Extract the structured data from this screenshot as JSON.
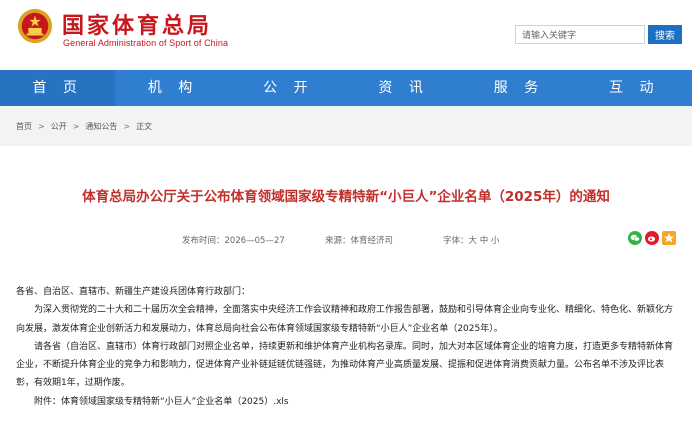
{
  "header": {
    "title_cn": "国家体育总局",
    "title_en": "General Administration of Sport of China",
    "emblem_icon": "national-emblem-icon",
    "search_placeholder": "请输入关键字",
    "search_button": "搜索"
  },
  "colors": {
    "brand_red": "#c8161d",
    "nav_blue": "#2f7ed0",
    "title_red": "#c22f2b",
    "search_blue": "#1c6fc3"
  },
  "nav": {
    "items": [
      "首 页",
      "机 构",
      "公 开",
      "资 讯",
      "服 务",
      "互 动"
    ]
  },
  "breadcrumb": {
    "items": [
      "首页",
      "公开",
      "通知公告",
      "正文"
    ],
    "separator": ">"
  },
  "article": {
    "title": "体育总局办公厅关于公布体育领域国家级专精特新“小巨人”企业名单（2025年）的通知",
    "date": "发布时间：2026—05—27",
    "source": "来源：体育经济司",
    "font_size": "字体：大 中 小",
    "share_icons": [
      "wechat-icon",
      "weibo-icon",
      "favorite-icon"
    ],
    "paragraphs": [
      "各省、自治区、直辖市、新疆生产建设兵团体育行政部门：",
      "为深入贯彻党的二十大和二十届历次全会精神，全面落实中央经济工作会议精神和政府工作报告部署，鼓励和引导体育企业向专业化、精细化、特色化、新颖化方向发展，激发体育企业创新活力和发展动力，体育总局向社会公布体育领域国家级专精特新“小巨人”企业名单（2025年）。",
      "请各省（自治区、直辖市）体育行政部门对照企业名单，持续更新和维护体育产业机构名录库。同时，加大对本区域体育企业的培育力度，打造更多专精特新体育企业，不断提升体育企业的竞争力和影响力，促进体育产业补链延链优链强链，为推动体育产业高质量发展、提振和促进体育消费贡献力量。公布名单不涉及评比表彰，有效期1年，过期作废。",
      "附件：体育领域国家级专精特新“小巨人”企业名单（2025）.xls"
    ]
  }
}
